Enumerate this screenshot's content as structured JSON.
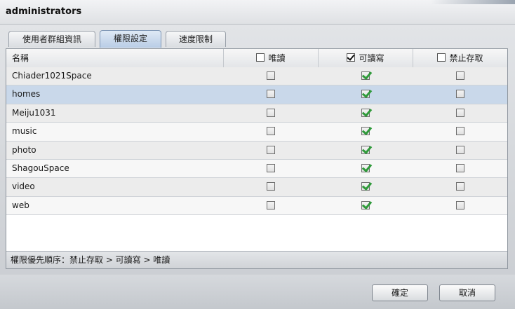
{
  "window": {
    "title": "administrators"
  },
  "tabs": [
    {
      "label": "使用者群組資訊",
      "active": false
    },
    {
      "label": "權限設定",
      "active": true
    },
    {
      "label": "速度限制",
      "active": false
    }
  ],
  "grid": {
    "headers": {
      "name": "名稱",
      "readonly": "唯讀",
      "readwrite": "可讀寫",
      "noaccess": "禁止存取"
    },
    "header_checks": {
      "readonly": false,
      "readwrite": true,
      "noaccess": false
    },
    "rows": [
      {
        "name": "Chiader1021Space",
        "readonly": false,
        "readwrite": true,
        "noaccess": false
      },
      {
        "name": "homes",
        "readonly": false,
        "readwrite": true,
        "noaccess": false,
        "selected": true
      },
      {
        "name": "Meiju1031",
        "readonly": false,
        "readwrite": true,
        "noaccess": false
      },
      {
        "name": "music",
        "readonly": false,
        "readwrite": true,
        "noaccess": false
      },
      {
        "name": "photo",
        "readonly": false,
        "readwrite": true,
        "noaccess": false
      },
      {
        "name": "ShagouSpace",
        "readonly": false,
        "readwrite": true,
        "noaccess": false
      },
      {
        "name": "video",
        "readonly": false,
        "readwrite": true,
        "noaccess": false
      },
      {
        "name": "web",
        "readonly": false,
        "readwrite": true,
        "noaccess": false
      }
    ],
    "footnote": "權限優先順序：禁止存取 > 可讀寫 > 唯讀"
  },
  "buttons": {
    "ok": "確定",
    "cancel": "取消"
  },
  "colors": {
    "selected_row": "#c9d8ea",
    "check_green": "#2f9a3a",
    "active_tab": "#b9cde6"
  }
}
